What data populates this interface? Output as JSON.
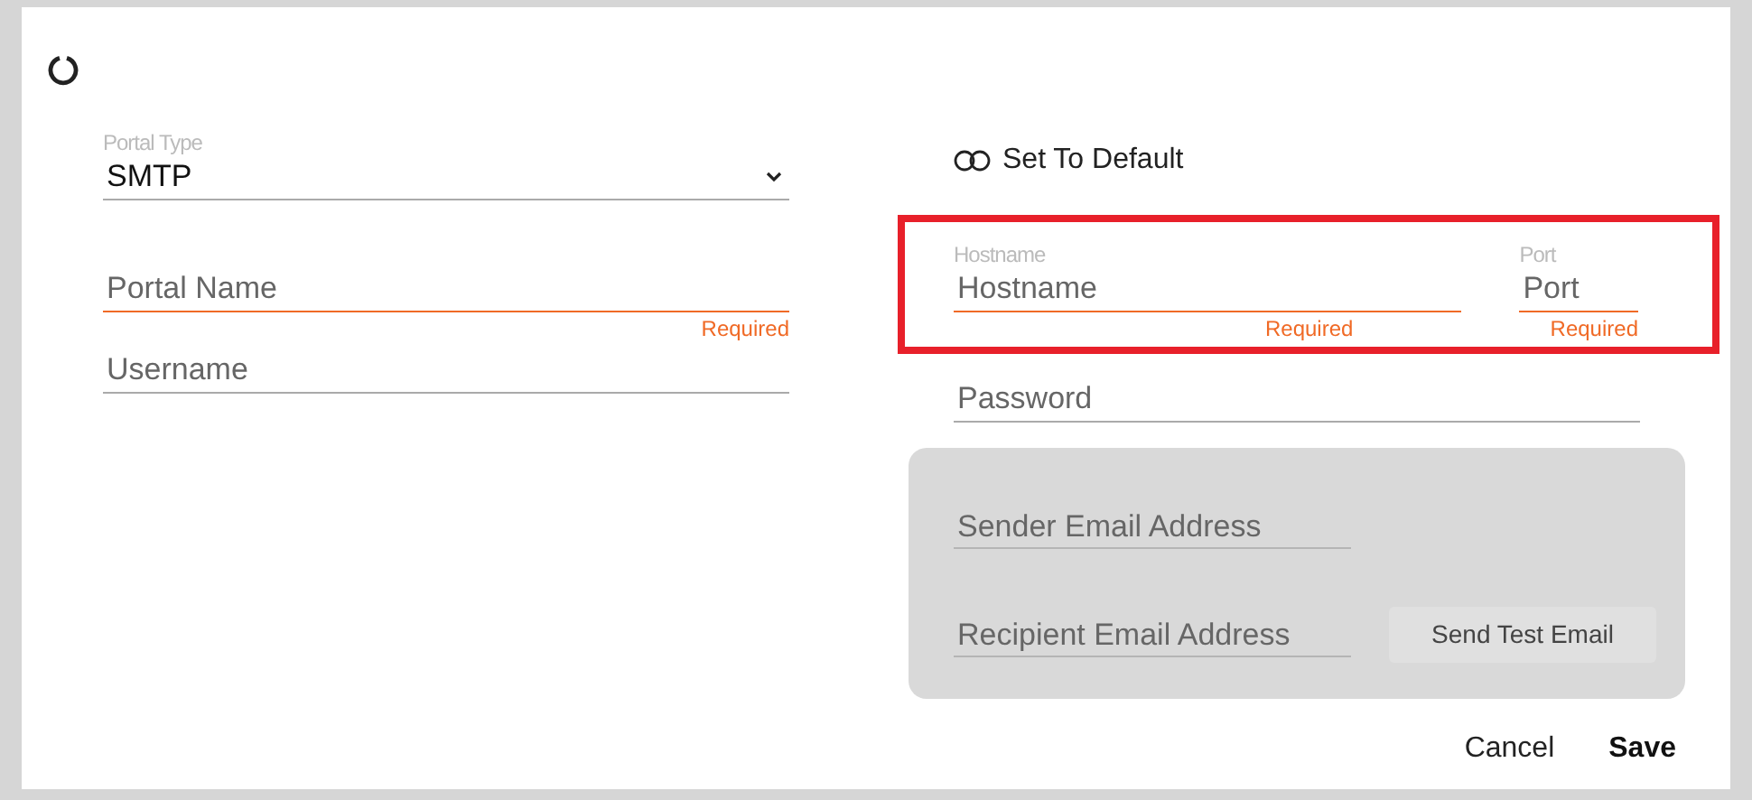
{
  "portal_type": {
    "label": "Portal Type",
    "value": "SMTP"
  },
  "left_fields": [
    {
      "placeholder": "Portal Name",
      "invalid": true,
      "error": "Required"
    },
    {
      "placeholder": "Username",
      "invalid": false
    }
  ],
  "set_to_default": {
    "label": "Set To Default",
    "on": false
  },
  "server": {
    "highlighted": true,
    "fields": [
      {
        "label": "Hostname",
        "placeholder": "Hostname",
        "invalid": true,
        "error": "Required",
        "kind": "wide"
      },
      {
        "label": "Port",
        "placeholder": "Port",
        "invalid": true,
        "error": "Required",
        "kind": "narrow"
      }
    ]
  },
  "password": {
    "placeholder": "Password",
    "invalid": false
  },
  "test_panel": {
    "sender": {
      "placeholder": "Sender Email Address",
      "invalid": false
    },
    "recipient": {
      "placeholder": "Recipient Email Address",
      "invalid": false
    },
    "button": "Send Test Email"
  },
  "actions": [
    {
      "label": "Cancel",
      "primary": false
    },
    {
      "label": "Save",
      "primary": true
    }
  ]
}
